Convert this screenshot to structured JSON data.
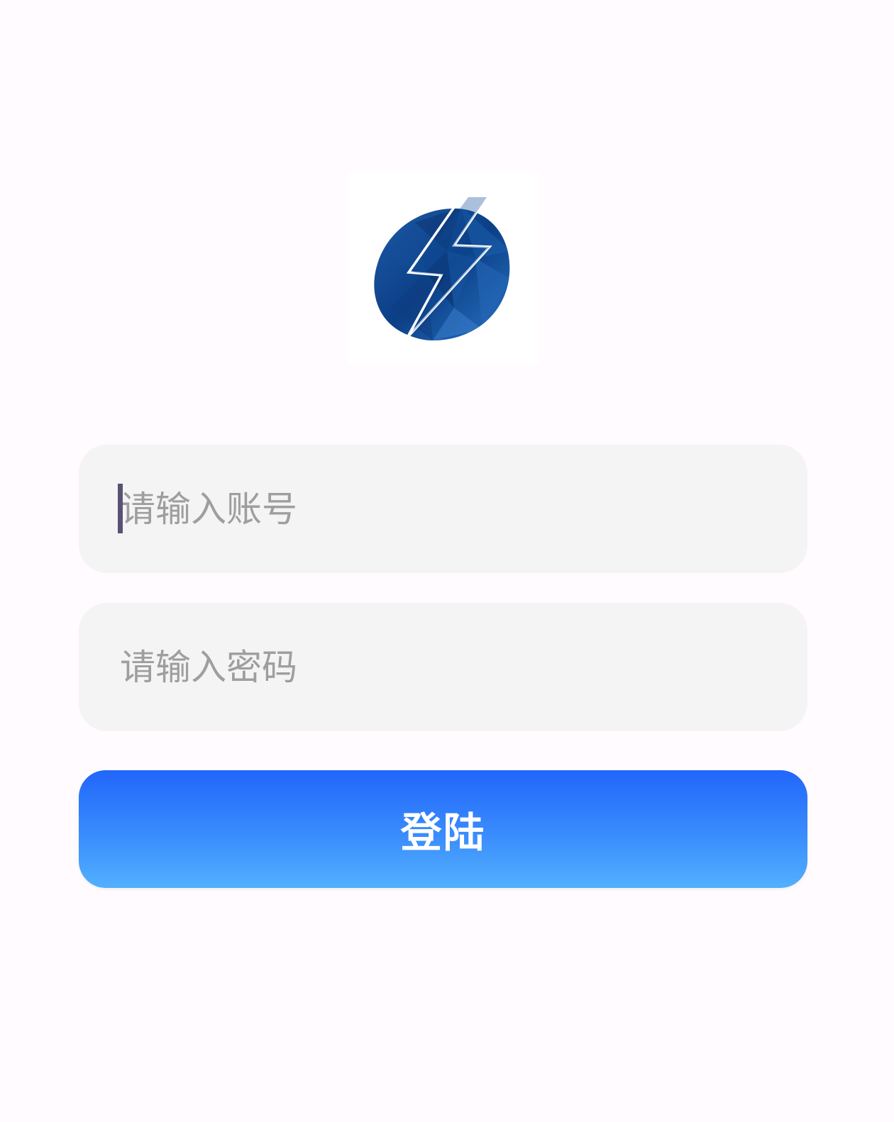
{
  "logo": {
    "icon": "lightning-bolt-logo-icon",
    "colors": {
      "circle_dark": "#0b3f86",
      "circle_light": "#2a73c4",
      "bolt_stroke": "#ffffff"
    }
  },
  "form": {
    "account_placeholder": "请输入账号",
    "account_value": "",
    "password_placeholder": "请输入密码",
    "password_value": "",
    "login_label": "登陆"
  },
  "colors": {
    "background": "#fffbfe",
    "field_bg": "#f3f4f3",
    "placeholder": "#9e9e9e",
    "button_gradient_top": "#2166fb",
    "button_gradient_bottom": "#52b0fd",
    "caret": "#5a5174"
  }
}
